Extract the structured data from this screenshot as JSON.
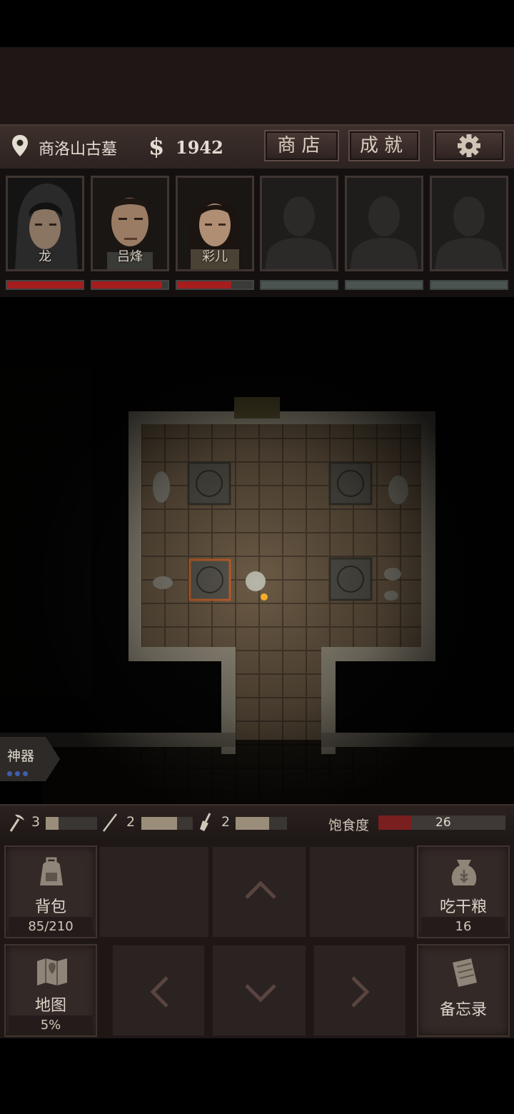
{
  "header": {
    "location": "商洛山古墓",
    "money_symbol": "$",
    "money": "1942",
    "shop_label": "商店",
    "achievements_label": "成就",
    "settings_icon": "gear-icon"
  },
  "party": [
    {
      "name": "龙",
      "health": 1.0
    },
    {
      "name": "吕烽",
      "health": 0.92
    },
    {
      "name": "彩儿",
      "health": 0.72
    },
    {
      "name": "",
      "health": null
    },
    {
      "name": "",
      "health": null
    },
    {
      "name": "",
      "health": null
    }
  ],
  "artifact": {
    "label": "神器",
    "charges": 3
  },
  "tools": [
    {
      "icon": "pickaxe-icon",
      "count": "3",
      "level": 0.25
    },
    {
      "icon": "staff-icon",
      "count": "2",
      "level": 0.7
    },
    {
      "icon": "shovel-icon",
      "count": "2",
      "level": 0.65
    }
  ],
  "satiety": {
    "label": "饱食度",
    "value": "26",
    "level": 0.26
  },
  "controls": {
    "backpack_label": "背包",
    "backpack_capacity": "85/210",
    "map_label": "地图",
    "map_progress": "5%",
    "eat_label": "吃干粮",
    "eat_count": "16",
    "memo_label": "备忘录"
  },
  "colors": {
    "health": "#a51d1d",
    "satiety": "#7a1f1f",
    "artifact_dot": "#3d5fb0"
  }
}
